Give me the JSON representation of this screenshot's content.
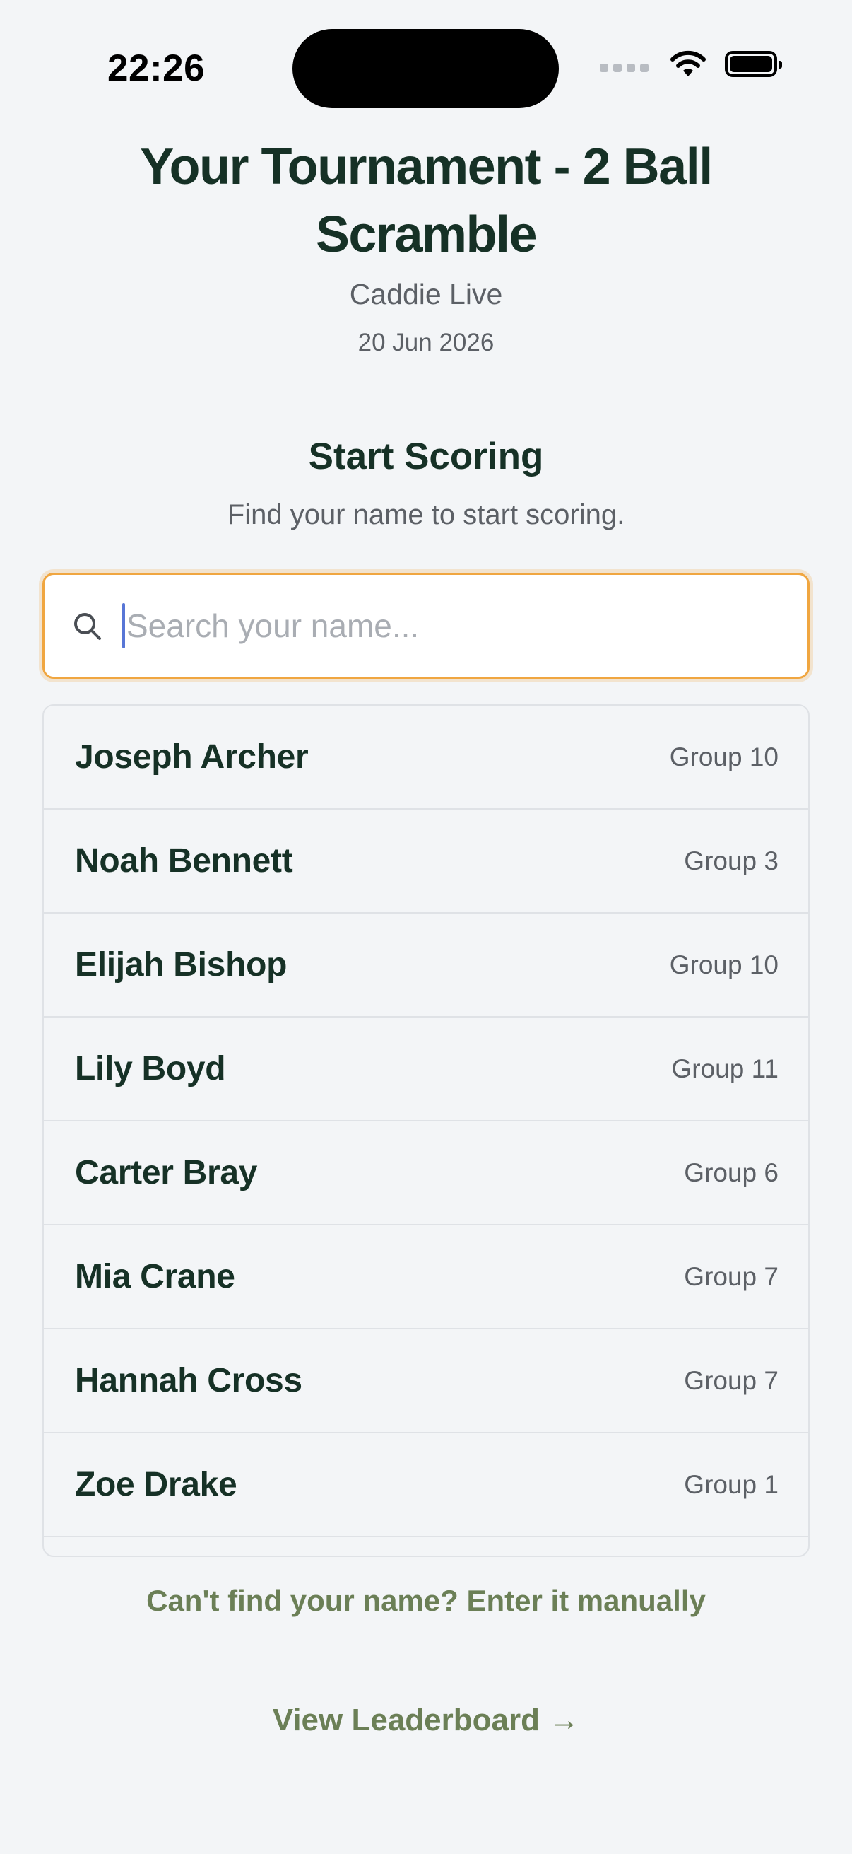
{
  "status_bar": {
    "time": "22:26"
  },
  "header": {
    "title": "Your Tournament - 2 Ball Scramble",
    "organizer": "Caddie Live",
    "date": "20 Jun 2026"
  },
  "scoring": {
    "title": "Start Scoring",
    "subtitle": "Find your name to start scoring."
  },
  "search": {
    "placeholder": "Search your name...",
    "value": ""
  },
  "players": [
    {
      "name": "Joseph Archer",
      "group": "Group 10"
    },
    {
      "name": "Noah Bennett",
      "group": "Group 3"
    },
    {
      "name": "Elijah Bishop",
      "group": "Group 10"
    },
    {
      "name": "Lily Boyd",
      "group": "Group 11"
    },
    {
      "name": "Carter Bray",
      "group": "Group 6"
    },
    {
      "name": "Mia Crane",
      "group": "Group 7"
    },
    {
      "name": "Hannah Cross",
      "group": "Group 7"
    },
    {
      "name": "Zoe Drake",
      "group": "Group 1"
    }
  ],
  "links": {
    "manual_entry": "Can't find your name? Enter it manually",
    "leaderboard": "View Leaderboard →"
  },
  "colors": {
    "background": "#f3f5f7",
    "heading": "#163126",
    "accent_link": "#6b7f56",
    "focus_border": "#f0a640",
    "caret": "#5876d6"
  },
  "icons": {
    "search": "search-icon",
    "wifi": "wifi-icon",
    "battery": "battery-icon",
    "signal": "cellular-signal-icon"
  }
}
